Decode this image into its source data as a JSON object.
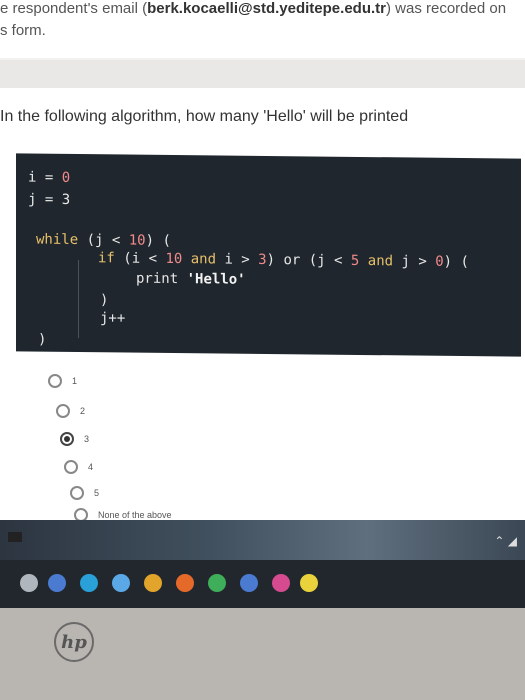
{
  "notice": {
    "prefix": "e respondent's email (",
    "email": "berk.kocaelli@std.yeditepe.edu.tr",
    "suffix": ") was recorded on",
    "line2": "s form."
  },
  "question": {
    "text": "In the following algorithm, how many 'Hello' will be printed"
  },
  "code": {
    "l1_var": "i",
    "l1_op": " = ",
    "l1_val": "0",
    "l2_var": "j",
    "l2_op": " = ",
    "l2_val": "3",
    "while_kw": "while",
    "while_cond_a": " (j < ",
    "while_num": "10",
    "while_cond_b": ") (",
    "if_kw": "if",
    "if_a": " (i < ",
    "if_num1": "10",
    "if_and1": " and",
    "if_b": " i > ",
    "if_num2": "3",
    "if_c": ") or (j < ",
    "if_num3": "5",
    "if_and2": " and",
    "if_d": " j > ",
    "if_num4": "0",
    "if_e": ") (",
    "print_kw": "print",
    "print_str": " 'Hello'",
    "close1": ")",
    "incr": "j++",
    "close2": ")"
  },
  "options": [
    {
      "label": "1",
      "selected": false
    },
    {
      "label": "2",
      "selected": false
    },
    {
      "label": "3",
      "selected": true
    },
    {
      "label": "4",
      "selected": false
    },
    {
      "label": "5",
      "selected": false
    },
    {
      "label": "None of the above",
      "selected": false
    }
  ],
  "tray": {
    "wifi_icon": "wifi-icon",
    "expand_icon": "chevron-up-icon"
  },
  "brand": {
    "logo_text": "hp"
  },
  "colors": {
    "code_bg": "#1f262d",
    "keyword": "#e8c06a",
    "number": "#f08a8a"
  }
}
